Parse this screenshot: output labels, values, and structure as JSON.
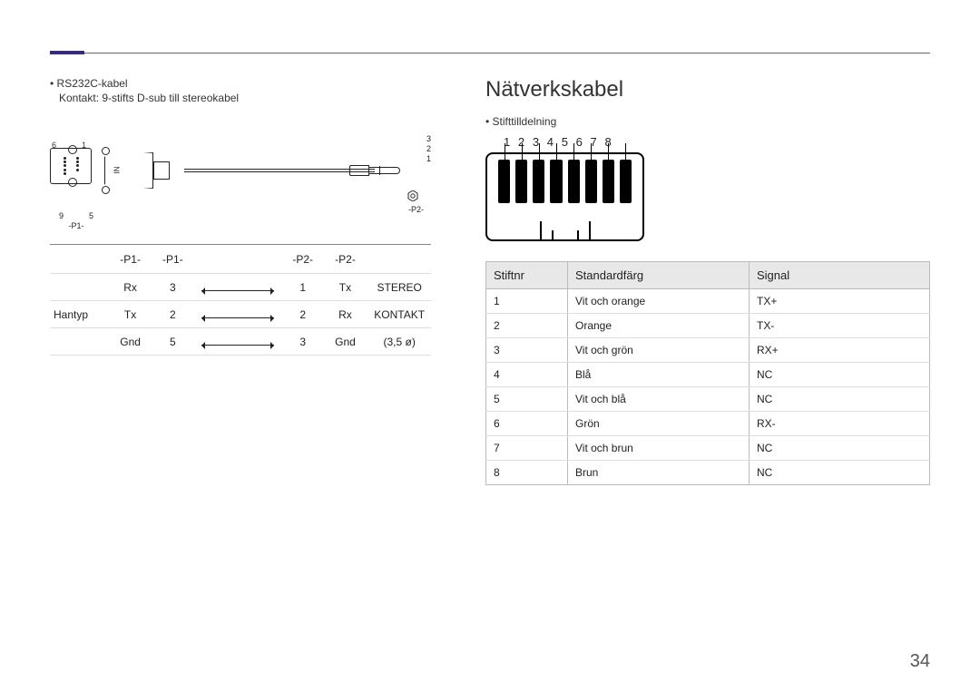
{
  "header_accent_color": "#3a2a7a",
  "rs232": {
    "bullet": "RS232C-kabel",
    "subline": "Kontakt: 9-stifts D-sub till stereokabel",
    "connector_label": "IN",
    "dsub_pins_top": [
      "6",
      "1"
    ],
    "dsub_pins_bottom": [
      "9",
      "5"
    ],
    "p1_caption": "-P1-",
    "trs_pins": [
      "3",
      "2",
      "1"
    ],
    "p2_caption": "-P2-",
    "table": {
      "headers": [
        "-P1-",
        "-P1-",
        "-P2-",
        "-P2-"
      ],
      "side_label": "Hantyp",
      "side_right_top": "STEREO",
      "side_right_mid": "KONTAKT",
      "side_right_bot": "(3,5 ø)",
      "rows": [
        {
          "p1_sig": "Rx",
          "p1_pin": "3",
          "p2_pin": "1",
          "p2_sig": "Tx"
        },
        {
          "p1_sig": "Tx",
          "p1_pin": "2",
          "p2_pin": "2",
          "p2_sig": "Rx"
        },
        {
          "p1_sig": "Gnd",
          "p1_pin": "5",
          "p2_pin": "3",
          "p2_sig": "Gnd"
        }
      ]
    }
  },
  "net": {
    "section_title": "Nätverkskabel",
    "bullet": "Stifttilldelning",
    "pin_numbers": [
      "1",
      "2",
      "3",
      "4",
      "5",
      "6",
      "7",
      "8"
    ],
    "columns": {
      "pin": "Stiftnr",
      "color": "Standardfärg",
      "signal": "Signal"
    },
    "rows": [
      {
        "pin": "1",
        "color": "Vit och orange",
        "signal": "TX+"
      },
      {
        "pin": "2",
        "color": "Orange",
        "signal": "TX-"
      },
      {
        "pin": "3",
        "color": "Vit och grön",
        "signal": "RX+"
      },
      {
        "pin": "4",
        "color": "Blå",
        "signal": "NC"
      },
      {
        "pin": "5",
        "color": "Vit och blå",
        "signal": "NC"
      },
      {
        "pin": "6",
        "color": "Grön",
        "signal": "RX-"
      },
      {
        "pin": "7",
        "color": "Vit och brun",
        "signal": "NC"
      },
      {
        "pin": "8",
        "color": "Brun",
        "signal": "NC"
      }
    ]
  },
  "page_number": "34"
}
